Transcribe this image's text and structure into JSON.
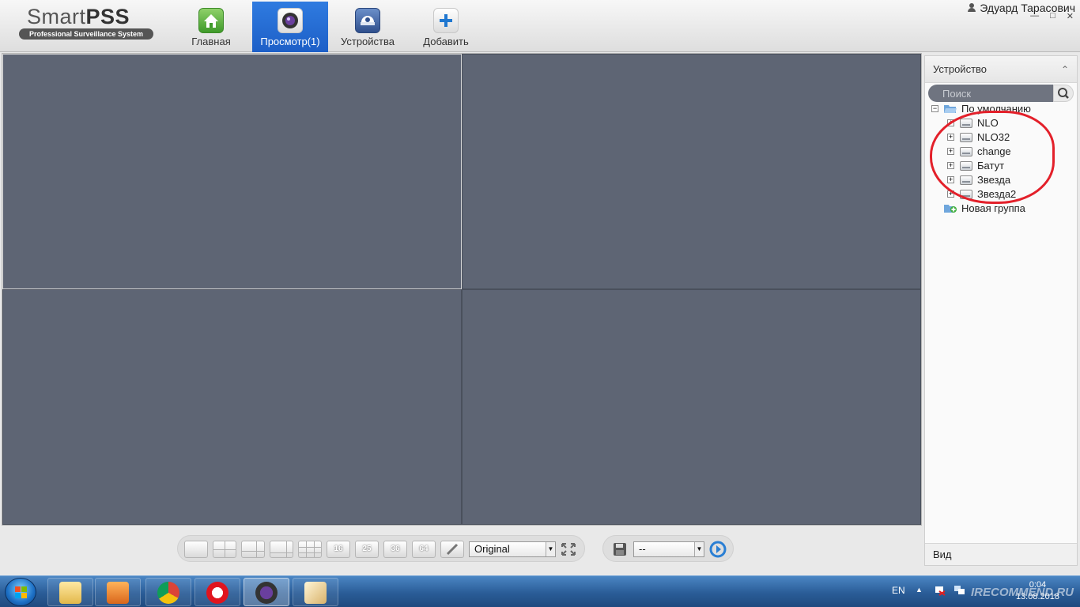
{
  "app": {
    "logo_title_plain": "Smart",
    "logo_title_bold": "PSS",
    "logo_subtitle": "Professional Surveillance System",
    "user_name": "Эдуард Тарасович"
  },
  "nav": {
    "home": "Главная",
    "live": "Просмотр(1)",
    "devices": "Устройства",
    "add": "Добавить"
  },
  "panel": {
    "title": "Устройство",
    "search_placeholder": "Поиск",
    "root_group": "По умолчанию",
    "devices": [
      "NLO",
      "NLO32",
      "change",
      "Батут",
      "Звезда",
      "Звезда2"
    ],
    "new_group": "Новая группа",
    "footer": "Вид"
  },
  "toolbar": {
    "layout_16": "16",
    "layout_25": "25",
    "layout_36": "36",
    "layout_64": "64",
    "stream_mode": "Original",
    "preset_value": "--"
  },
  "taskbar": {
    "lang": "EN",
    "time": "0:04",
    "date": "13.08.2018",
    "watermark": "IRECOMMEND.RU"
  },
  "colors": {
    "video_bg": "#5e6574",
    "active_tab": "#1d5fc7",
    "highlight_loop": "#e3202a"
  }
}
